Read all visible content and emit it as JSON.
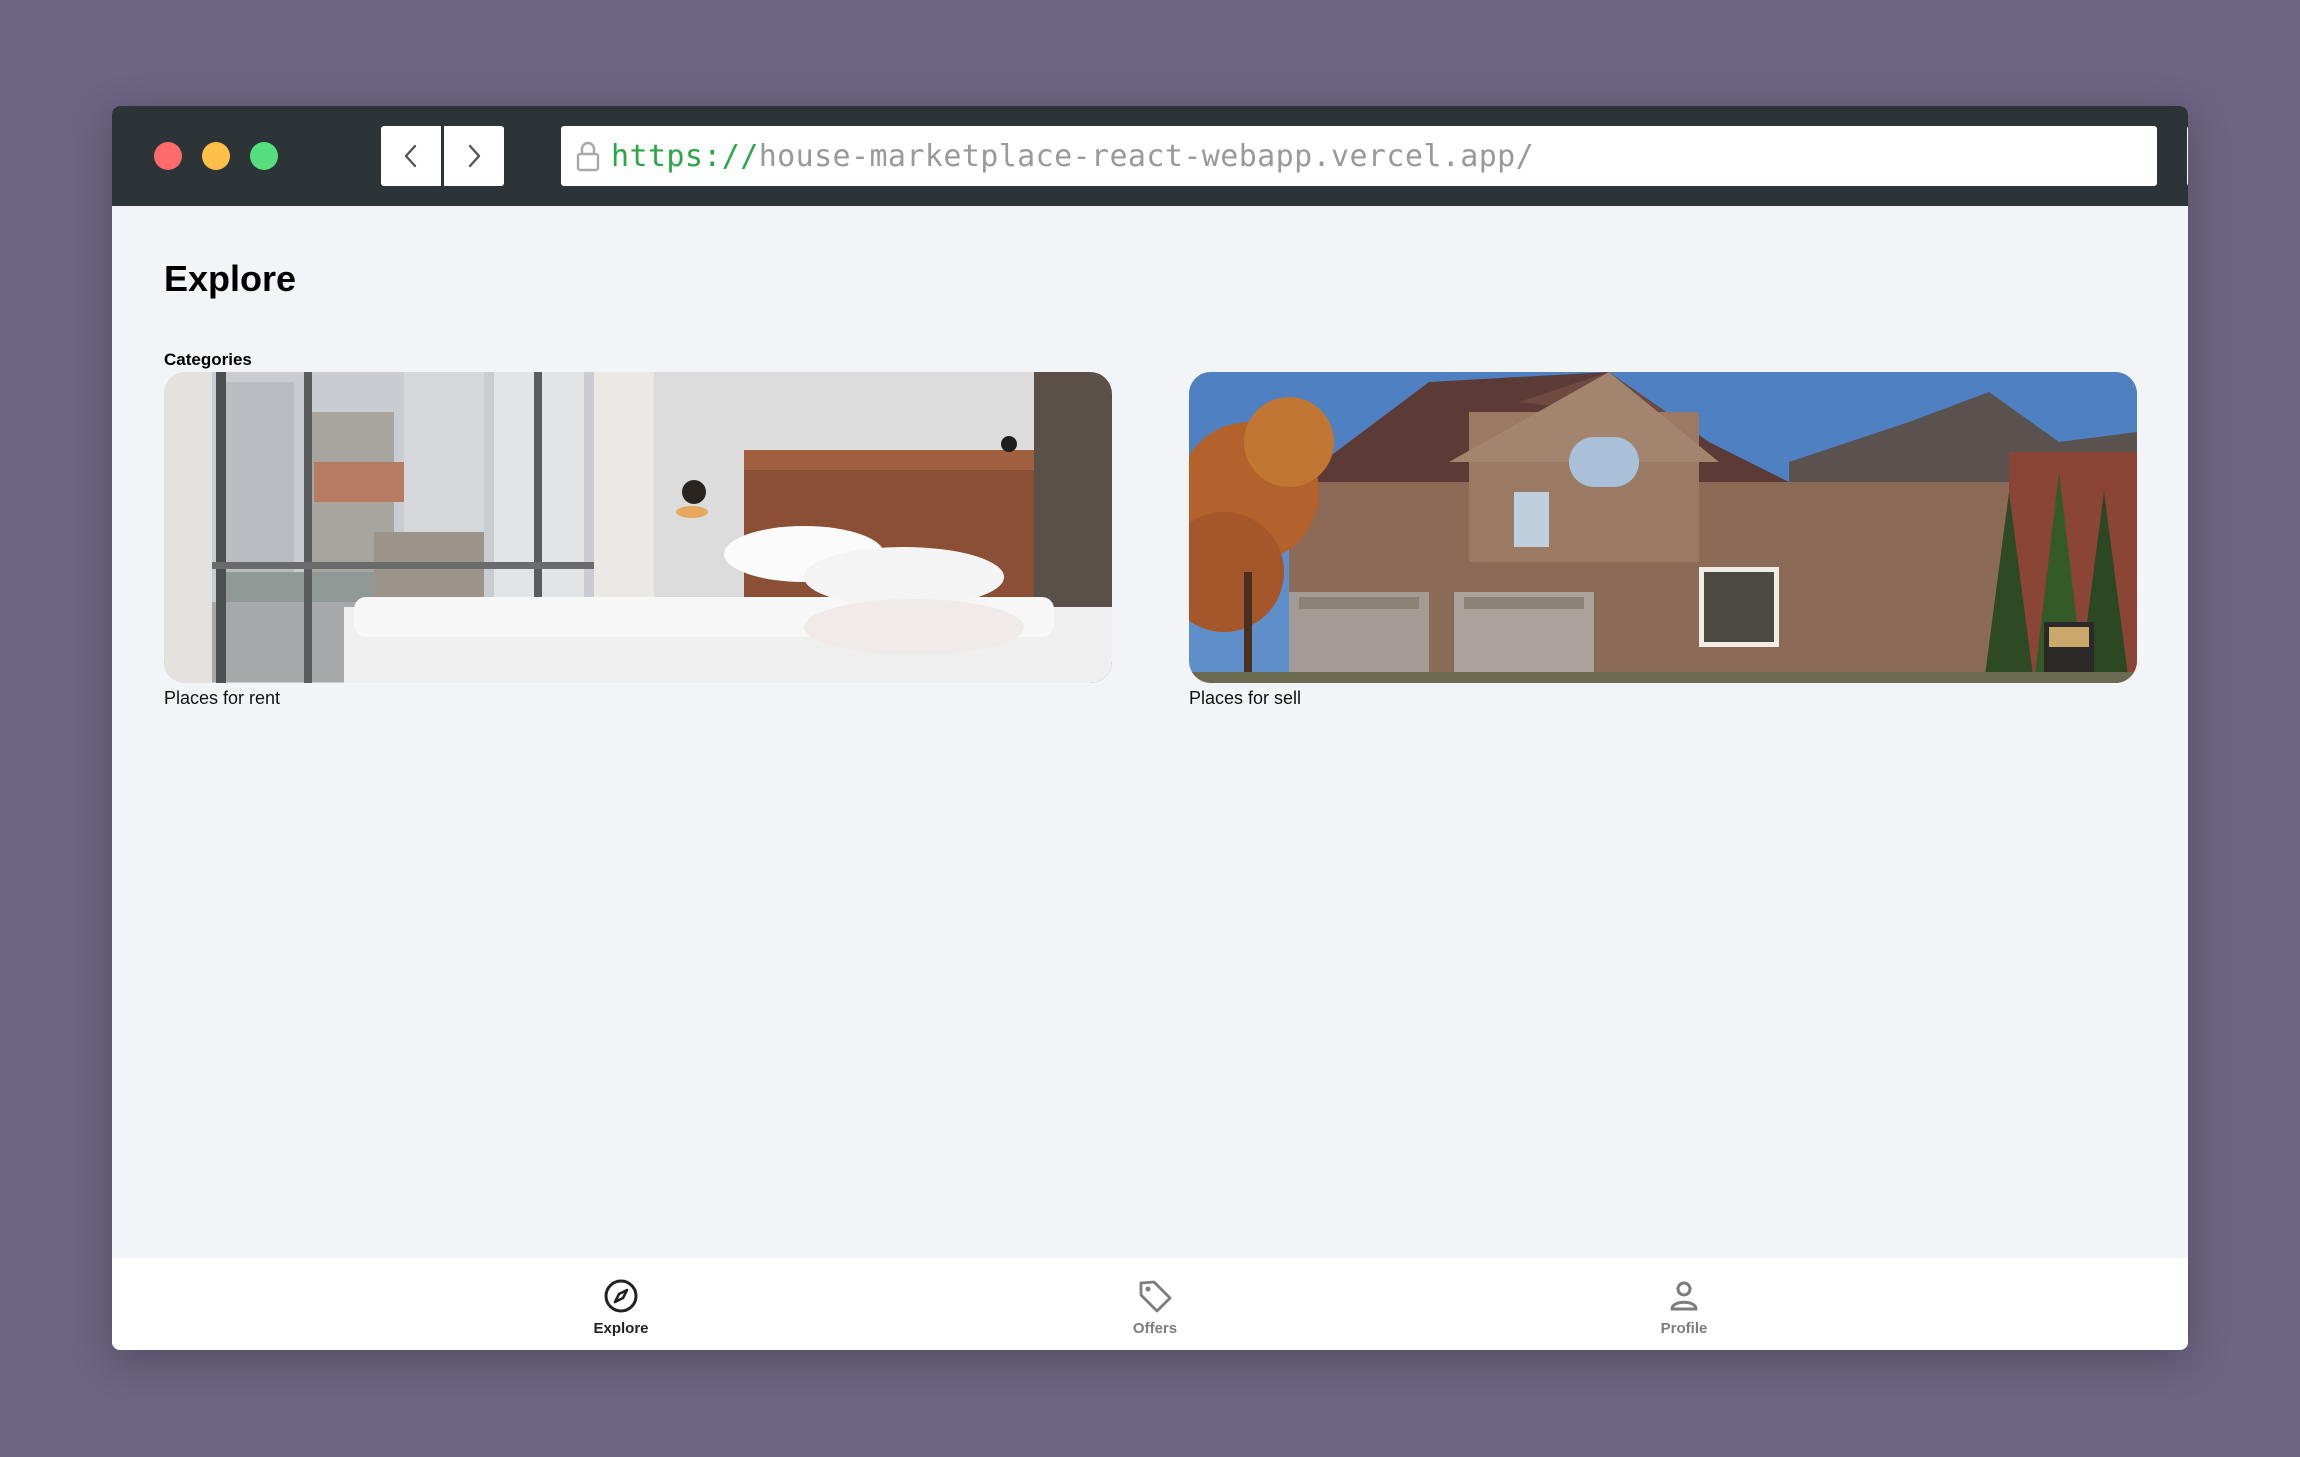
{
  "browser": {
    "url_scheme": "https://",
    "url_host": "house-marketplace-react-webapp.vercel.app/"
  },
  "page": {
    "title": "Explore",
    "categories_label": "Categories",
    "categories": [
      {
        "label": "Places for rent"
      },
      {
        "label": "Places for sell"
      }
    ]
  },
  "tabbar": {
    "items": [
      {
        "label": "Explore",
        "icon": "compass-icon",
        "active": true
      },
      {
        "label": "Offers",
        "icon": "tag-icon",
        "active": false
      },
      {
        "label": "Profile",
        "icon": "person-icon",
        "active": false
      }
    ]
  },
  "colors": {
    "page_background": "#6e6483",
    "titlebar": "#2c3437",
    "content_background": "#f2f4f8",
    "url_scheme": "#2aa845"
  }
}
